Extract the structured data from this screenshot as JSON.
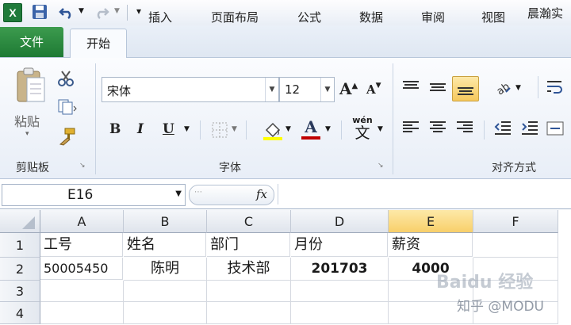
{
  "qat": {
    "doc_title": "晨瀚实"
  },
  "tabs": [
    "文件",
    "开始",
    "插入",
    "页面布局",
    "公式",
    "数据",
    "审阅",
    "视图"
  ],
  "ribbon": {
    "clipboard": {
      "paste": "粘贴",
      "label": "剪贴板"
    },
    "font": {
      "name": "宋体",
      "size": "12",
      "label": "字体",
      "bold": "B",
      "italic": "I",
      "underline": "U",
      "font_color_letter": "A",
      "grow": "A",
      "shrink": "A",
      "phonetic": "wén",
      "phonetic_char": "文"
    },
    "align": {
      "label": "对齐方式"
    }
  },
  "formula_bar": {
    "name_box": "E16",
    "fx": "fx"
  },
  "grid": {
    "columns": [
      "A",
      "B",
      "C",
      "D",
      "E",
      "F"
    ],
    "rows": [
      "1",
      "2",
      "3",
      "4"
    ],
    "cells": {
      "A1": "工号",
      "B1": "姓名",
      "C1": "部门",
      "D1": "月份",
      "E1": "薪资",
      "A2": "50005450",
      "B2": "陈明",
      "C2": "技术部",
      "D2": "201703",
      "E2": "4000"
    }
  },
  "watermark": {
    "site": "Baidu 经验",
    "source": "知乎 @MODU"
  },
  "colors": {
    "file_tab": "#1e7a34",
    "selected_column": "#f8cf6a",
    "font_color": "#c00000",
    "fill_color": "#ffff00"
  }
}
